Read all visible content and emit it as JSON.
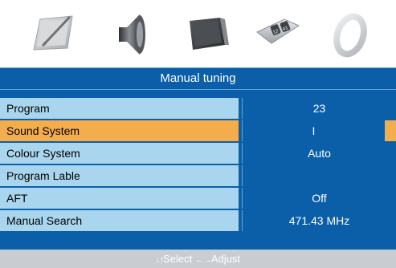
{
  "menu_tabs": [
    {
      "icon": "picture-pen-icon"
    },
    {
      "icon": "speaker-icon"
    },
    {
      "icon": "screen-icon"
    },
    {
      "icon": "channel-tag-icon"
    },
    {
      "icon": "ring-icon"
    }
  ],
  "title": "Manual tuning",
  "rows": [
    {
      "label": "Program",
      "value": "23"
    },
    {
      "label": "Sound System",
      "value": "I"
    },
    {
      "label": "Colour System",
      "value": "Auto"
    },
    {
      "label": "Program Lable",
      "value": ""
    },
    {
      "label": "AFT",
      "value": "Off"
    },
    {
      "label": "Manual Search",
      "value": "471.43 MHz"
    }
  ],
  "selected_row_index": 1,
  "hint": {
    "select_arrows": "↓↑",
    "select_label": "Select",
    "adjust_arrows": "←→",
    "adjust_label": "Adjust"
  },
  "colors": {
    "panel_blue": "#0a5fa8",
    "row_light": "#a9d6ee",
    "highlight": "#f4ad4c",
    "hint_bar": "#c9cdd2"
  }
}
